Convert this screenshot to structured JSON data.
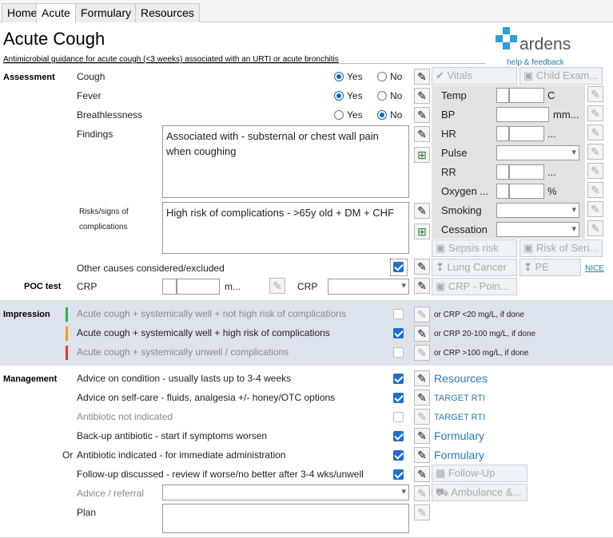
{
  "tabs": [
    "Home",
    "Acute",
    "Formulary",
    "Resources"
  ],
  "header": {
    "title": "Acute Cough",
    "subtitle": "Antimicrobial guidance for acute cough (<3 weeks) associated with an URTI or acute bronchitis",
    "brand": "ardens",
    "help": "help & feedback"
  },
  "assessment": {
    "section": "Assessment",
    "cough": "Cough",
    "fever": "Fever",
    "breathlessness": "Breathlessness",
    "yes": "Yes",
    "no": "No",
    "findings_label": "Findings",
    "findings_value": "Associated with - substernal or chest wall pain when coughing",
    "risks_label": "Risks/signs of complications",
    "risks_value": "High risk of complications - >65y old + DM + CHF",
    "other_causes": "Other causes considered/excluded"
  },
  "poc": {
    "section": "POC test",
    "crp1": "CRP",
    "unit": "m...",
    "crp2": "CRP"
  },
  "side": {
    "vitals": "Vitals",
    "child_exam": "Child Exam...",
    "sepsis": "Sepsis risk",
    "risk_seri": "Risk of Seri...",
    "lung_cancer": "Lung Cancer",
    "pe": "PE",
    "nice": "NICE",
    "crp_poin": "CRP - Poin..."
  },
  "vitals": {
    "temp": "Temp",
    "temp_unit": "C",
    "bp": "BP",
    "bp_unit": "mm...",
    "hr": "HR",
    "hr_unit": "...",
    "pulse": "Pulse",
    "rr": "RR",
    "rr_unit": "...",
    "oxygen": "Oxygen ...",
    "oxygen_unit": "%",
    "smoking": "Smoking",
    "cessation": "Cessation"
  },
  "impression": {
    "section": "Impression",
    "items": [
      {
        "label": "Acute cough + systemically well + not high risk of complications",
        "checked": false,
        "note": "or CRP <20 mg/L, if done",
        "color": "#2db34a"
      },
      {
        "label": "Acute cough + systemically well + high risk of complications",
        "checked": true,
        "note": "or CRP 20-100 mg/L, if done",
        "color": "#f5a000"
      },
      {
        "label": "Acute cough + systemically unwell / complications",
        "checked": false,
        "note": "or CRP >100 mg/L, if done",
        "color": "#e53935"
      }
    ]
  },
  "management": {
    "section": "Management",
    "or": "Or",
    "items": [
      {
        "label": "Advice on condition - usually lasts up to 3-4 weeks",
        "checked": true,
        "link": "Resources"
      },
      {
        "label": "Advice on self-care - fluids, analgesia +/- honey/OTC options",
        "checked": true,
        "link": "TARGET RTI"
      },
      {
        "label": "Antibiotic not indicated",
        "checked": false,
        "link": "TARGET RTI"
      },
      {
        "label": "Back-up antibiotic - start if symptoms worsen",
        "checked": true,
        "link": "Formulary"
      },
      {
        "label": "Antibiotic indicated - for immediate administration",
        "checked": true,
        "link": "Formulary"
      },
      {
        "label": "Follow-up discussed - review if worse/no better after 3-4 wks/unwell",
        "checked": true,
        "link": "Follow-Up"
      }
    ],
    "advice_referral": "Advice / referral",
    "ambulance": "Ambulance &...",
    "plan": "Plan"
  },
  "colors": {
    "accent": "#1565c0",
    "link": "#2a7ab8",
    "impression_bg": "#dde3ec"
  }
}
